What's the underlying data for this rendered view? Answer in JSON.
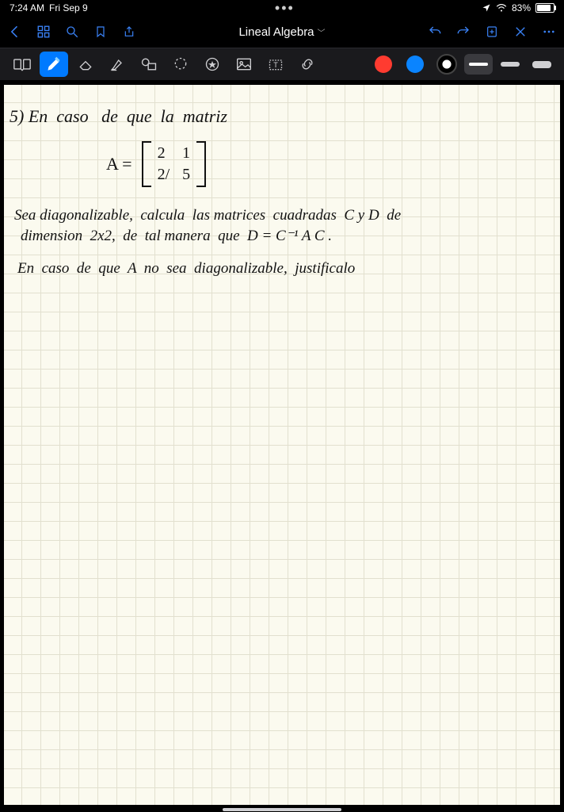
{
  "status": {
    "time": "7:24 AM",
    "date": "Fri Sep 9",
    "battery_pct": "83%",
    "battery_fill_pct": 83
  },
  "nav": {
    "title": "Lineal Algebra"
  },
  "toolbar": {
    "colors": {
      "red": "#ff3b30",
      "blue": "#0a84ff"
    }
  },
  "notes": {
    "line1": "5) En  caso   de  que  la  matriz",
    "matrix_label": "A =",
    "m11": "2",
    "m12": "1",
    "m21": "2/",
    "m22": "5",
    "line2a": "Sea diagonalizable,  calcula  las matrices  cuadradas  C y D  de",
    "line2b": "dimension  2x2,  de  tal manera  que  D = C⁻¹ A C .",
    "line3": "En  caso  de  que  A  no  sea  diagonalizable,  justificalo"
  }
}
